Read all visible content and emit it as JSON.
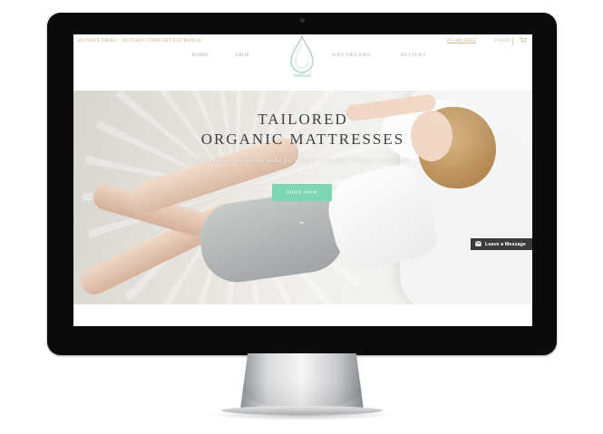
{
  "header": {
    "promo": "100 DAYS TRIAL · 365 DAYS COMFORT EXCHANGE",
    "phone": "855-MILKBED",
    "login": "LOGIN",
    "cart_icon": "cart-icon",
    "logo_text": "milkbed",
    "nav": [
      "HOME",
      "SHOP",
      "WHY ORGANIC",
      "REVIEWS"
    ]
  },
  "hero": {
    "title_line1": "TAILORED",
    "title_line2": "ORGANIC MATTRESSES",
    "subtitle": "Pure organic materials make for a truly enjoyable sleeping experience.",
    "cta": "SHOP NOW",
    "scroll_icon": "chevron-down-icon"
  },
  "chat": {
    "label": "Leave a Message",
    "icon": "mail-icon"
  },
  "colors": {
    "accent_gold": "#c8a46a",
    "cta_green": "#7dd7b2",
    "logo_green": "#9fc8b9",
    "chat_bg": "#3b3b3b"
  }
}
